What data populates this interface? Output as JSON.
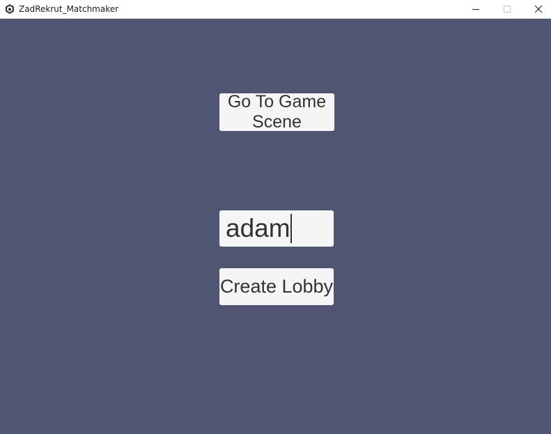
{
  "window": {
    "title": "ZadRekrut_Matchmaker",
    "icon": "unity-icon",
    "controls": {
      "minimize_icon": "minimize-icon",
      "maximize_icon": "maximize-icon",
      "close_icon": "close-icon"
    }
  },
  "scene": {
    "background_color": "#505671",
    "go_to_game_button": {
      "line1": "Go To Game",
      "line2": "Scene"
    },
    "name_input": {
      "value": "adam"
    },
    "create_lobby_button": {
      "label": "Create Lobby"
    }
  }
}
